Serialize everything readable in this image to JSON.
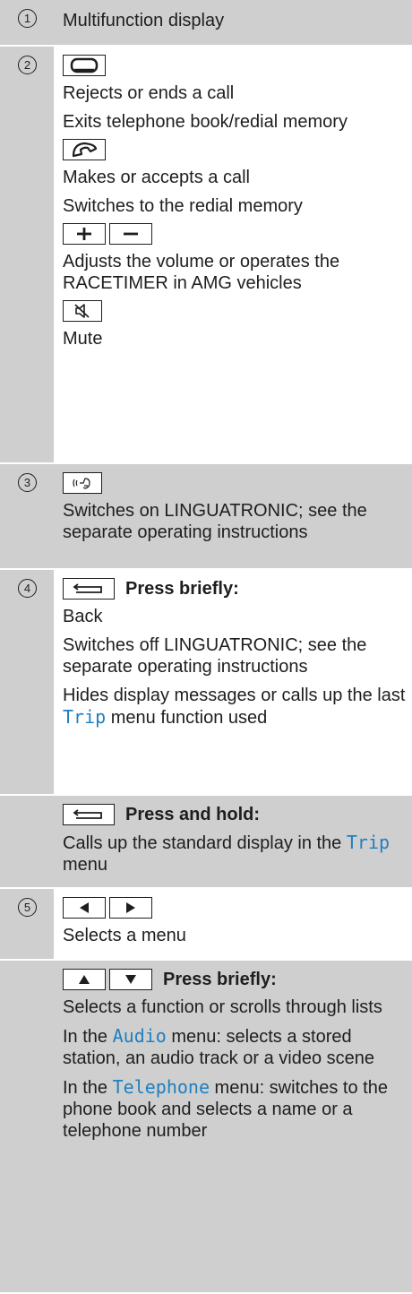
{
  "rows": {
    "r1": {
      "num": "1",
      "text": "Multifunction display"
    },
    "r2": {
      "num": "2",
      "end_desc1": "Rejects or ends a call",
      "end_desc2": "Exits telephone book/redial memory",
      "call_desc1": "Makes or accepts a call",
      "call_desc2": "Switches to the redial memory",
      "vol_desc": "Adjusts the volume or operates the RACETIMER in AMG vehicles",
      "mute_desc": "Mute"
    },
    "r3": {
      "num": "3",
      "desc": "Switches on LINGUATRONIC; see the separate operating instructions"
    },
    "r4": {
      "num": "4",
      "label": "Press briefly:",
      "desc1": "Back",
      "desc2": "Switches off LINGUATRONIC; see the separate operating instructions",
      "desc3_pre": "Hides display messages or calls up the last ",
      "desc3_code": "Trip",
      "desc3_post": " menu function used"
    },
    "r4b": {
      "label": "Press and hold:",
      "desc_pre": "Calls up the standard display in the ",
      "desc_code": "Trip",
      "desc_post": " menu"
    },
    "r5": {
      "num": "5",
      "desc": "Selects a menu"
    },
    "r5b": {
      "label": "Press briefly:",
      "desc1": "Selects a function or scrolls through lists",
      "desc2_pre": "In the ",
      "desc2_code": "Audio",
      "desc2_post": " menu: selects a stored station, an audio track or a video scene",
      "desc3_pre": "In the ",
      "desc3_code": "Telephone",
      "desc3_post": " menu: switches to the phone book and selects a name or a telephone number"
    }
  }
}
